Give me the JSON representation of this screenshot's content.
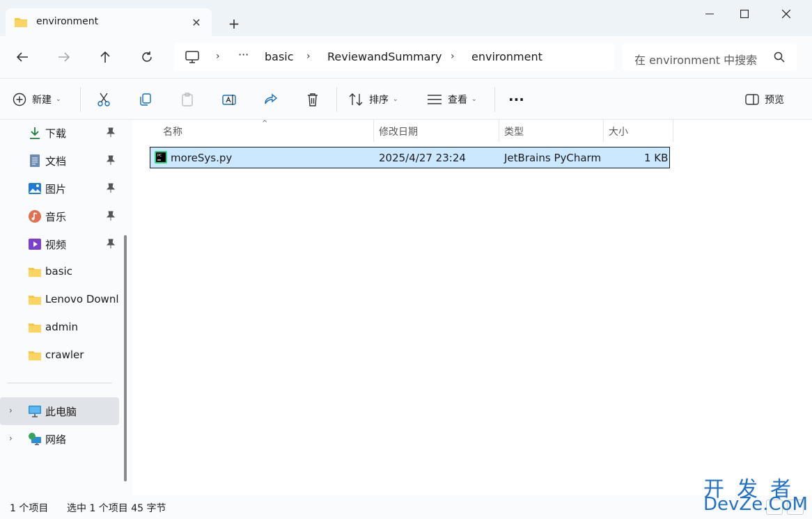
{
  "tab": {
    "title": "environment",
    "close_glyph": "✕",
    "add_glyph": "+"
  },
  "window": {
    "minimize_icon": "minimize-icon",
    "maximize_icon": "maximize-icon",
    "close_icon": "close-icon"
  },
  "nav_buttons": [
    "back-arrow-icon",
    "forward-arrow-icon",
    "up-arrow-icon",
    "refresh-icon"
  ],
  "breadcrumb": {
    "overflow": "···",
    "items": [
      "basic",
      "ReviewandSummary",
      "environment"
    ],
    "separator": "›"
  },
  "search": {
    "placeholder": "在 environment 中搜索"
  },
  "commands": {
    "new_label": "新建",
    "sort_label": "排序",
    "view_label": "查看",
    "more_glyph": "···",
    "preview_label": "预览",
    "caret": "⌄"
  },
  "sidebar": {
    "pin_glyph": "📌",
    "items": [
      {
        "label": "下载",
        "icon": "download-icon",
        "pinned": true
      },
      {
        "label": "文档",
        "icon": "document-icon",
        "pinned": true
      },
      {
        "label": "图片",
        "icon": "pictures-icon",
        "pinned": true
      },
      {
        "label": "音乐",
        "icon": "music-icon",
        "pinned": true
      },
      {
        "label": "视频",
        "icon": "videos-icon",
        "pinned": true
      },
      {
        "label": "basic",
        "icon": "folder-icon",
        "pinned": false
      },
      {
        "label": "Lenovo Downlo",
        "icon": "folder-icon",
        "pinned": false
      },
      {
        "label": "admin",
        "icon": "folder-icon",
        "pinned": false
      },
      {
        "label": "crawler",
        "icon": "folder-icon",
        "pinned": false
      }
    ],
    "this_pc": "此电脑",
    "network": "网络",
    "expand_glyph": "›"
  },
  "table": {
    "columns": [
      "名称",
      "修改日期",
      "类型",
      "大小"
    ],
    "sort_glyph": "^",
    "rows": [
      {
        "name": "moreSys.py",
        "modified": "2025/4/27 23:24",
        "type": "JetBrains PyCharm",
        "size": "1 KB",
        "selected": true
      }
    ]
  },
  "status": {
    "count": "1 个项目",
    "selection": "选中 1 个项目  45 字节"
  },
  "watermark": {
    "line1": "开发者",
    "line2": "DevZe.CoM"
  },
  "colors": {
    "accent": "#0067c0",
    "selection": "#cce8ff",
    "folder": "#f8c940",
    "watermark": "#2271c8"
  }
}
